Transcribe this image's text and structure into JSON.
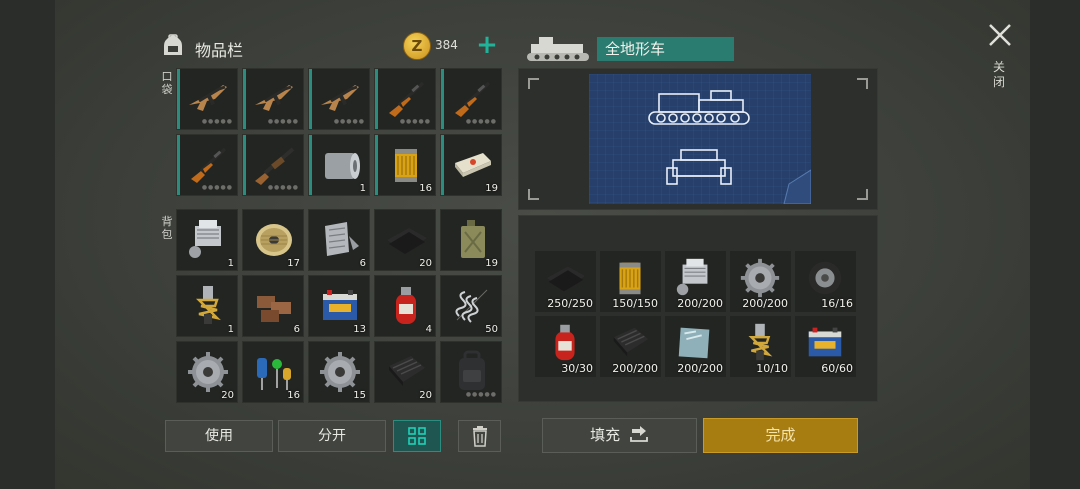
{
  "inventory": {
    "title": "物品栏",
    "coins": "384",
    "pocket_label": "口袋",
    "backpack_label": "背包",
    "pocket_items": [
      {
        "icon": "assault-rifle-icon",
        "count": ""
      },
      {
        "icon": "assault-rifle-icon",
        "count": ""
      },
      {
        "icon": "assault-rifle-icon",
        "count": ""
      },
      {
        "icon": "hunting-rifle-icon",
        "count": ""
      },
      {
        "icon": "hunting-rifle-icon",
        "count": ""
      },
      {
        "icon": "hunting-rifle-icon",
        "count": ""
      },
      {
        "icon": "shotgun-icon",
        "count": ""
      },
      {
        "icon": "metal-sheet-roll-icon",
        "count": "1"
      },
      {
        "icon": "oil-filter-icon",
        "count": "16"
      },
      {
        "icon": "explosive-brick-icon",
        "count": "19"
      }
    ],
    "backpack_items": [
      {
        "icon": "engine-block-icon",
        "count": "1"
      },
      {
        "icon": "wire-spool-icon",
        "count": "17"
      },
      {
        "icon": "metal-scrap-icon",
        "count": "6"
      },
      {
        "icon": "rubber-sheet-icon",
        "count": "20"
      },
      {
        "icon": "jerrycan-icon",
        "count": "19"
      },
      {
        "icon": "shock-absorber-icon",
        "count": "1"
      },
      {
        "icon": "bricks-icon",
        "count": "6"
      },
      {
        "icon": "car-battery-icon",
        "count": "13"
      },
      {
        "icon": "gas-cylinder-icon",
        "count": "4"
      },
      {
        "icon": "spring-icon",
        "count": "50"
      },
      {
        "icon": "gear-icon",
        "count": "20"
      },
      {
        "icon": "electronic-parts-icon",
        "count": "16"
      },
      {
        "icon": "gear-icon",
        "count": "15"
      },
      {
        "icon": "carbon-sheet-icon",
        "count": "20"
      },
      {
        "icon": "backpack-icon",
        "count": ""
      }
    ]
  },
  "buttons": {
    "use": "使用",
    "split": "分开",
    "fill": "填充",
    "done": "完成"
  },
  "recipe": {
    "title": "全地形车",
    "close_label": "关闭",
    "requirements": [
      {
        "icon": "rubber-sheet-icon",
        "count": "250/250"
      },
      {
        "icon": "oil-filter-icon",
        "count": "150/150"
      },
      {
        "icon": "engine-block-icon",
        "count": "200/200"
      },
      {
        "icon": "gear-icon",
        "count": "200/200"
      },
      {
        "icon": "wheel-icon",
        "count": "16/16"
      },
      {
        "icon": "gas-cylinder-icon",
        "count": "30/30"
      },
      {
        "icon": "carbon-sheet-icon",
        "count": "200/200"
      },
      {
        "icon": "glass-panel-icon",
        "count": "200/200"
      },
      {
        "icon": "shock-absorber-icon",
        "count": "10/10"
      },
      {
        "icon": "car-battery-icon",
        "count": "60/60"
      }
    ]
  },
  "colors": {
    "accent": "#2a8d80",
    "done": "#a77d12",
    "coin": "#e6b93a",
    "blueprint": "#26406b"
  }
}
